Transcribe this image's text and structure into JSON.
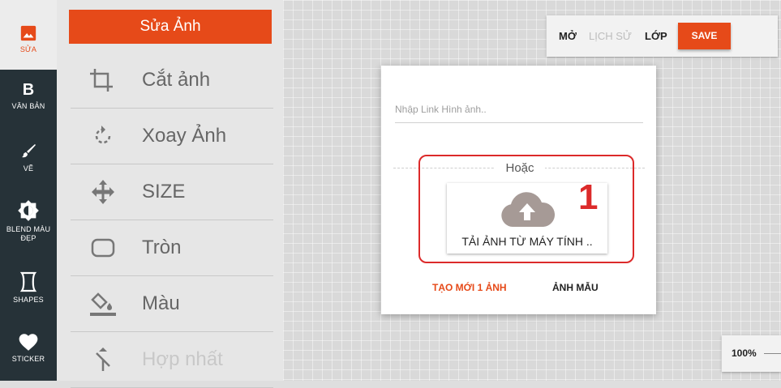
{
  "sidebar": {
    "items": [
      {
        "label": "SỬA",
        "icon": "image-icon",
        "active": true
      },
      {
        "label": "VĂN BẢN",
        "icon": "bold-b-icon",
        "glyph": "B"
      },
      {
        "label": "VẼ",
        "icon": "brush-icon"
      },
      {
        "label": "BLEND MÀU ĐẸP",
        "icon": "contrast-icon"
      },
      {
        "label": "SHAPES",
        "icon": "shapes-icon"
      },
      {
        "label": "STICKER",
        "icon": "heart-icon"
      }
    ]
  },
  "panel": {
    "title": "Sửa Ảnh",
    "tools": [
      {
        "label": "Cắt ảnh",
        "icon": "crop-icon"
      },
      {
        "label": "Xoay Ảnh",
        "icon": "rotate-icon"
      },
      {
        "label": "SIZE",
        "icon": "move-arrows-icon"
      },
      {
        "label": "Tròn",
        "icon": "rounded-rect-icon"
      },
      {
        "label": "Màu",
        "icon": "paint-bucket-icon"
      },
      {
        "label": "Hợp nhất",
        "icon": "merge-icon",
        "disabled": true
      }
    ]
  },
  "toolbar": {
    "open_label": "MỞ",
    "history_label": "LỊCH SỬ",
    "layers_label": "LỚP",
    "save_label": "SAVE"
  },
  "dialog": {
    "link_placeholder": "Nhập Link Hình ảnh..",
    "or_text": "Hoặc",
    "upload_label": "TẢI ẢNH TỪ MÁY TÍNH ..",
    "step_number": "1",
    "create_label": "TẠO MỚI 1 ẢNH",
    "sample_label": "ẢNH MẪU"
  },
  "zoom": {
    "level": "100%"
  },
  "colors": {
    "accent": "#e64a19",
    "rail": "#263238",
    "annotation": "#dc2a2a"
  }
}
